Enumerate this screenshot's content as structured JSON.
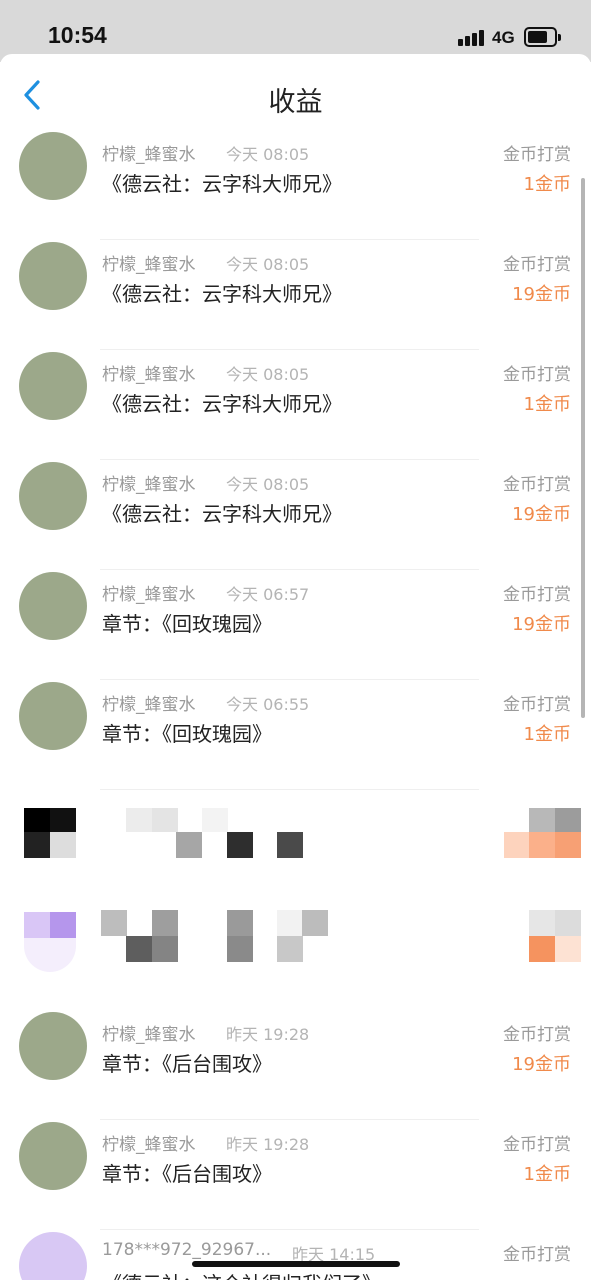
{
  "status_bar": {
    "time": "10:54",
    "network": "4G"
  },
  "nav": {
    "title": "收益"
  },
  "rows": [
    {
      "name": "柠檬_蜂蜜水",
      "time": "今天 08:05",
      "title": "《德云社：云字科大师兄》",
      "type": "金币打赏",
      "amount": "1金币"
    },
    {
      "name": "柠檬_蜂蜜水",
      "time": "今天 08:05",
      "title": "《德云社：云字科大师兄》",
      "type": "金币打赏",
      "amount": "19金币"
    },
    {
      "name": "柠檬_蜂蜜水",
      "time": "今天 08:05",
      "title": "《德云社：云字科大师兄》",
      "type": "金币打赏",
      "amount": "1金币"
    },
    {
      "name": "柠檬_蜂蜜水",
      "time": "今天 08:05",
      "title": "《德云社：云字科大师兄》",
      "type": "金币打赏",
      "amount": "19金币"
    },
    {
      "name": "柠檬_蜂蜜水",
      "time": "今天 06:57",
      "title": "章节：《回玫瑰园》",
      "type": "金币打赏",
      "amount": "19金币"
    },
    {
      "name": "柠檬_蜂蜜水",
      "time": "今天 06:55",
      "title": "章节：《回玫瑰园》",
      "type": "金币打赏",
      "amount": "1金币"
    },
    {
      "name": "柠檬_蜂蜜水",
      "time": "昨天 19:28",
      "title": "章节：《后台围攻》",
      "type": "金币打赏",
      "amount": "19金币"
    },
    {
      "name": "柠檬_蜂蜜水",
      "time": "昨天 19:28",
      "title": "章节：《后台围攻》",
      "type": "金币打赏",
      "amount": "1金币"
    },
    {
      "name": "178***972_92967...",
      "time": "昨天 14:15",
      "title": "《德云社：这个社得归我们了》",
      "type": "金币打赏",
      "amount": ""
    }
  ],
  "colors": {
    "accent": "#f08a4b",
    "back_icon": "#1e90e0",
    "avatar": "#9ca88a"
  },
  "icons": {
    "back": "chevron-left-icon"
  }
}
